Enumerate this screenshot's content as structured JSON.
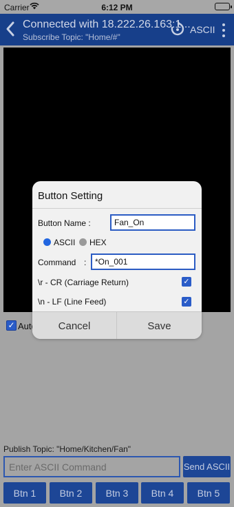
{
  "status_bar": {
    "carrier": "Carrier",
    "time": "6:12 PM"
  },
  "nav": {
    "title": "Connected with 18.222.26.163:1...",
    "subtitle": "Subscribe Topic: \"Home/#\"",
    "mode": "ASCII"
  },
  "autoscroll": {
    "label": "Auto Scroll",
    "checked": true
  },
  "dialog": {
    "title": "Button Setting",
    "button_name_label": "Button Name :",
    "button_name_value": "Fan_On",
    "radio_ascii": "ASCII",
    "radio_hex": "HEX",
    "selected_format": "ASCII",
    "command_label": "Command",
    "command_colon": ":",
    "command_value": "*On_001",
    "cr_label": "\\r - CR (Carriage Return)",
    "lf_label": "\\n - LF (Line Feed)",
    "cr_checked": true,
    "lf_checked": true,
    "cancel_label": "Cancel",
    "save_label": "Save"
  },
  "publish_topic": "Publish Topic: \"Home/Kitchen/Fan\"",
  "command_input": {
    "placeholder": "Enter ASCII Command",
    "value": ""
  },
  "send_button": "Send ASCII",
  "buttons": [
    "Btn 1",
    "Btn 2",
    "Btn 3",
    "Btn 4",
    "Btn 5"
  ],
  "colors": {
    "navbar": "#173f8a",
    "button": "#1d4696",
    "background": "#a4a4a4",
    "accent": "#2266e0"
  }
}
